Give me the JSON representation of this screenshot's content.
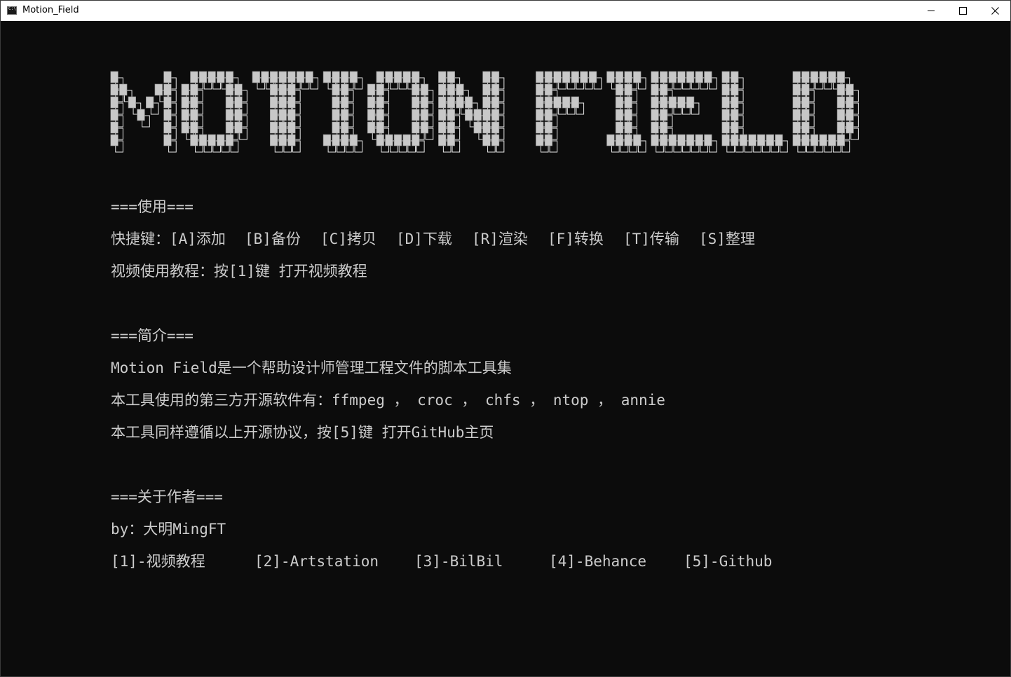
{
  "window": {
    "title": "Motion_Field"
  },
  "banner": {
    "text": "MOTION FIELD",
    "color": "#c8c8c8",
    "outline": "#e8e8e8"
  },
  "usage": {
    "header": "===使用===",
    "shortcuts_prefix": "快捷键：",
    "shortcuts": [
      "[A]添加",
      "[B]备份",
      "[C]拷贝",
      "[D]下载",
      "[R]渲染",
      "[F]转换",
      "[T]传输",
      "[S]整理"
    ],
    "video_tutorial": "视频使用教程：按[1]键 打开视频教程"
  },
  "intro": {
    "header": "===简介===",
    "line1": "Motion Field是一个帮助设计师管理工程文件的脚本工具集",
    "line2": "本工具使用的第三方开源软件有：ffmpeg ， croc ， chfs ， ntop ， annie",
    "line3": "本工具同样遵循以上开源协议，按[5]键 打开GitHub主页"
  },
  "about": {
    "header": "===关于作者===",
    "author": "by：大明MingFT",
    "links": [
      "[1]-视频教程",
      "[2]-Artstation",
      "[3]-BilBil",
      "[4]-Behance",
      "[5]-Github"
    ]
  },
  "colors": {
    "console_bg": "#0c0c0c",
    "console_text": "#cccccc",
    "titlebar_bg": "#ffffff"
  },
  "icons": {
    "app": "console-icon",
    "minimize": "minimize-icon",
    "maximize": "maximize-icon",
    "close": "close-icon"
  }
}
